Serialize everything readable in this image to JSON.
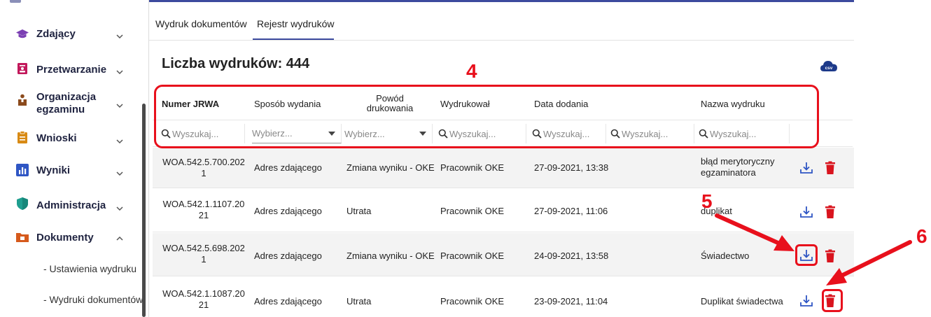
{
  "sidebar": {
    "items": [
      {
        "label": "Zdający",
        "icon": "graduation-cap-icon",
        "expanded": false
      },
      {
        "label": "Przetwarzanie",
        "icon": "id-card-icon",
        "expanded": false
      },
      {
        "label": "Organizacja egzaminu",
        "label_line1": "Organizacja",
        "label_line2": "egzaminu",
        "icon": "person-desk-icon",
        "expanded": false
      },
      {
        "label": "Wnioski",
        "icon": "clipboard-icon",
        "expanded": false
      },
      {
        "label": "Wyniki",
        "icon": "bar-chart-icon",
        "expanded": false
      },
      {
        "label": "Administracja",
        "icon": "shield-icon",
        "expanded": false
      },
      {
        "label": "Dokumenty",
        "icon": "folder-icon",
        "expanded": true
      }
    ],
    "subitems": [
      "- Ustawienia wydruku",
      "- Wydruki dokumentów"
    ]
  },
  "tabs": [
    {
      "label": "Wydruk dokumentów",
      "active": false
    },
    {
      "label": "Rejestr wydruków",
      "active": true
    }
  ],
  "main": {
    "title": "Liczba wydruków: 444",
    "csv_label": "csv"
  },
  "table": {
    "headers": {
      "jrwa": "Numer JRWA",
      "sposob": "Sposób wydania",
      "powod_line1": "Powód",
      "powod_line2": "drukowania",
      "wydrukowal": "Wydrukował",
      "data": "Data dodania",
      "nazwa": "Nazwa wydruku"
    },
    "filters": {
      "search_placeholder": "Wyszukaj...",
      "select_placeholder": "Wybierz..."
    },
    "rows": [
      {
        "jrwa_line1": "WOA.542.5.700.202",
        "jrwa_line2": "1",
        "sposob": "Adres zdającego",
        "powod": "Zmiana wyniku - OKE",
        "wydrukowal": "Pracownik OKE",
        "data": "27-09-2021, 13:38",
        "nazwa_line1": "błąd merytoryczny",
        "nazwa_line2": "egzaminatora"
      },
      {
        "jrwa_line1": "WOA.542.1.1107.20",
        "jrwa_line2": "21",
        "sposob": "Adres zdającego",
        "powod": "Utrata",
        "wydrukowal": "Pracownik OKE",
        "data": "27-09-2021, 11:06",
        "nazwa_line1": "duplikat",
        "nazwa_line2": ""
      },
      {
        "jrwa_line1": "WOA.542.5.698.202",
        "jrwa_line2": "1",
        "sposob": "Adres zdającego",
        "powod": "Zmiana wyniku - OKE",
        "wydrukowal": "Pracownik OKE",
        "data": "24-09-2021, 13:58",
        "nazwa_line1": "Świadectwo",
        "nazwa_line2": ""
      },
      {
        "jrwa_line1": "WOA.542.1.1087.20",
        "jrwa_line2": "21",
        "sposob": "Adres zdającego",
        "powod": "Utrata",
        "wydrukowal": "Pracownik OKE",
        "data": "23-09-2021, 11:04",
        "nazwa_line1": "Duplikat świadectwa",
        "nazwa_line2": ""
      }
    ]
  },
  "annotations": {
    "n4": "4",
    "n5": "5",
    "n6": "6",
    "color": "#e8101c"
  },
  "colors": {
    "accent": "#3c4a9e",
    "danger": "#d9141e",
    "icon_blue": "#2f56c4"
  }
}
